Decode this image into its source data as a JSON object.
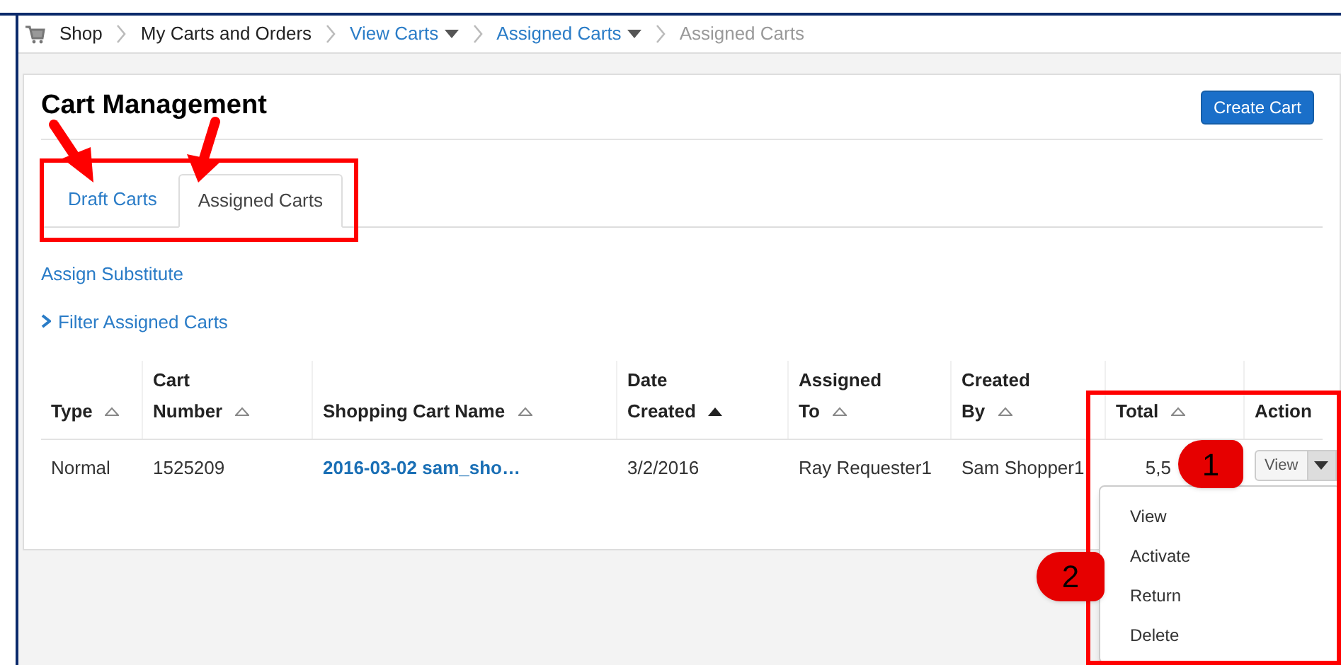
{
  "breadcrumb": [
    {
      "label": "Shop",
      "kind": "home"
    },
    {
      "label": "My Carts and Orders",
      "kind": "text"
    },
    {
      "label": "View Carts",
      "kind": "menu"
    },
    {
      "label": "Assigned Carts",
      "kind": "menu"
    },
    {
      "label": "Assigned Carts",
      "kind": "current"
    }
  ],
  "page": {
    "title": "Cart Management",
    "create_button": "Create Cart"
  },
  "tabs": [
    {
      "label": "Draft Carts",
      "selected": false
    },
    {
      "label": "Assigned Carts",
      "selected": true
    }
  ],
  "links": {
    "assign_substitute": "Assign Substitute",
    "filter": {
      "label": "Filter Assigned Carts",
      "expanded": false
    }
  },
  "table": {
    "columns": [
      {
        "label": "Type",
        "sorted": false
      },
      {
        "above": "Cart",
        "label": "Number",
        "sorted": false
      },
      {
        "label": "Shopping Cart Name",
        "sorted": false
      },
      {
        "above": "Date",
        "label": "Created",
        "sorted": true
      },
      {
        "above": "Assigned",
        "label": "To",
        "sorted": false
      },
      {
        "above": "Created",
        "label": "By",
        "sorted": false
      },
      {
        "label": "Total",
        "sorted": false
      },
      {
        "label": "Action"
      }
    ],
    "rows": [
      {
        "type": "Normal",
        "number": "1525209",
        "name": "2016-03-02 sam_sho…",
        "date": "3/2/2016",
        "assigned_to": "Ray Requester1",
        "created_by": "Sam Shopper1",
        "total": "5,5",
        "action": "View"
      }
    ]
  },
  "action_menu": {
    "expanded": true,
    "items": [
      "View",
      "Activate",
      "Return",
      "Delete"
    ]
  },
  "callouts": [
    "1",
    "2"
  ]
}
